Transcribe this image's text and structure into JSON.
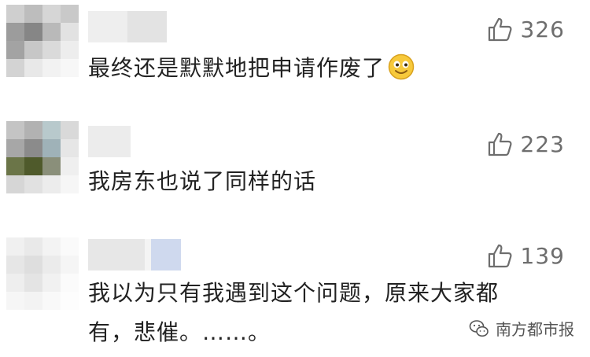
{
  "comments": [
    {
      "text": "最终还是默默地把申请作废了",
      "emoji": "smiling-face-emoji",
      "likes": "326"
    },
    {
      "text": "我房东也说了同样的话",
      "likes": "223"
    },
    {
      "text_line1": "我以为只有我遇到这个问题，原来大家都",
      "text_line2": "有，悲催。……。",
      "likes": "139"
    }
  ],
  "watermark": {
    "label": "南方都市报",
    "icon": "wechat-icon"
  },
  "colors": {
    "text": "#222222",
    "like_gray": "#6e6e6e"
  }
}
